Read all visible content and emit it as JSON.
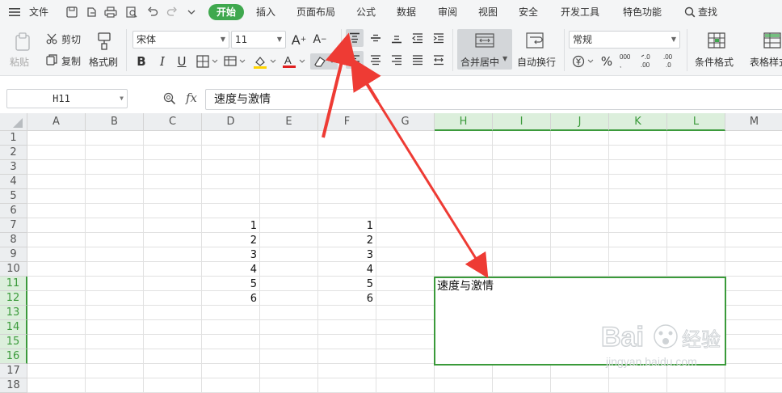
{
  "menu": {
    "file_label": "文件",
    "tabs": [
      "开始",
      "插入",
      "页面布局",
      "公式",
      "数据",
      "审阅",
      "视图",
      "安全",
      "开发工具",
      "特色功能"
    ],
    "search_label": "查找"
  },
  "ribbon": {
    "paste_label": "粘贴",
    "cut_label": "剪切",
    "copy_label": "复制",
    "format_painter_label": "格式刷",
    "font_name": "宋体",
    "font_size": "11",
    "merge_center_label": "合并居中",
    "wrap_text_label": "自动换行",
    "number_format": "常规",
    "conditional_format_label": "条件格式",
    "table_style_label": "表格样式"
  },
  "formula_bar": {
    "name_box": "H11",
    "fx_label": "fx",
    "content": "速度与激情"
  },
  "sheet": {
    "columns": [
      "A",
      "B",
      "C",
      "D",
      "E",
      "F",
      "G",
      "H",
      "I",
      "J",
      "K",
      "L",
      "M"
    ],
    "rows": [
      "1",
      "2",
      "3",
      "4",
      "5",
      "6",
      "7",
      "8",
      "9",
      "10",
      "11",
      "12",
      "13",
      "14",
      "15",
      "16",
      "17",
      "18"
    ],
    "col_d_values": [
      "1",
      "2",
      "3",
      "4",
      "5",
      "6"
    ],
    "col_f_values": [
      "1",
      "2",
      "3",
      "4",
      "5",
      "6"
    ],
    "merged_cell_text": "速度与激情",
    "selected_columns": [
      "H",
      "I",
      "J",
      "K",
      "L"
    ],
    "selected_rows": [
      "11",
      "12",
      "13",
      "14",
      "15",
      "16"
    ]
  },
  "watermark": {
    "brand": "Bai",
    "brand_cn": "经验",
    "url": "jingyan.baidu.com"
  },
  "colors": {
    "accent_green": "#3fa84e",
    "selection_green": "#3a9a3a",
    "arrow_red": "#ee3b34"
  }
}
